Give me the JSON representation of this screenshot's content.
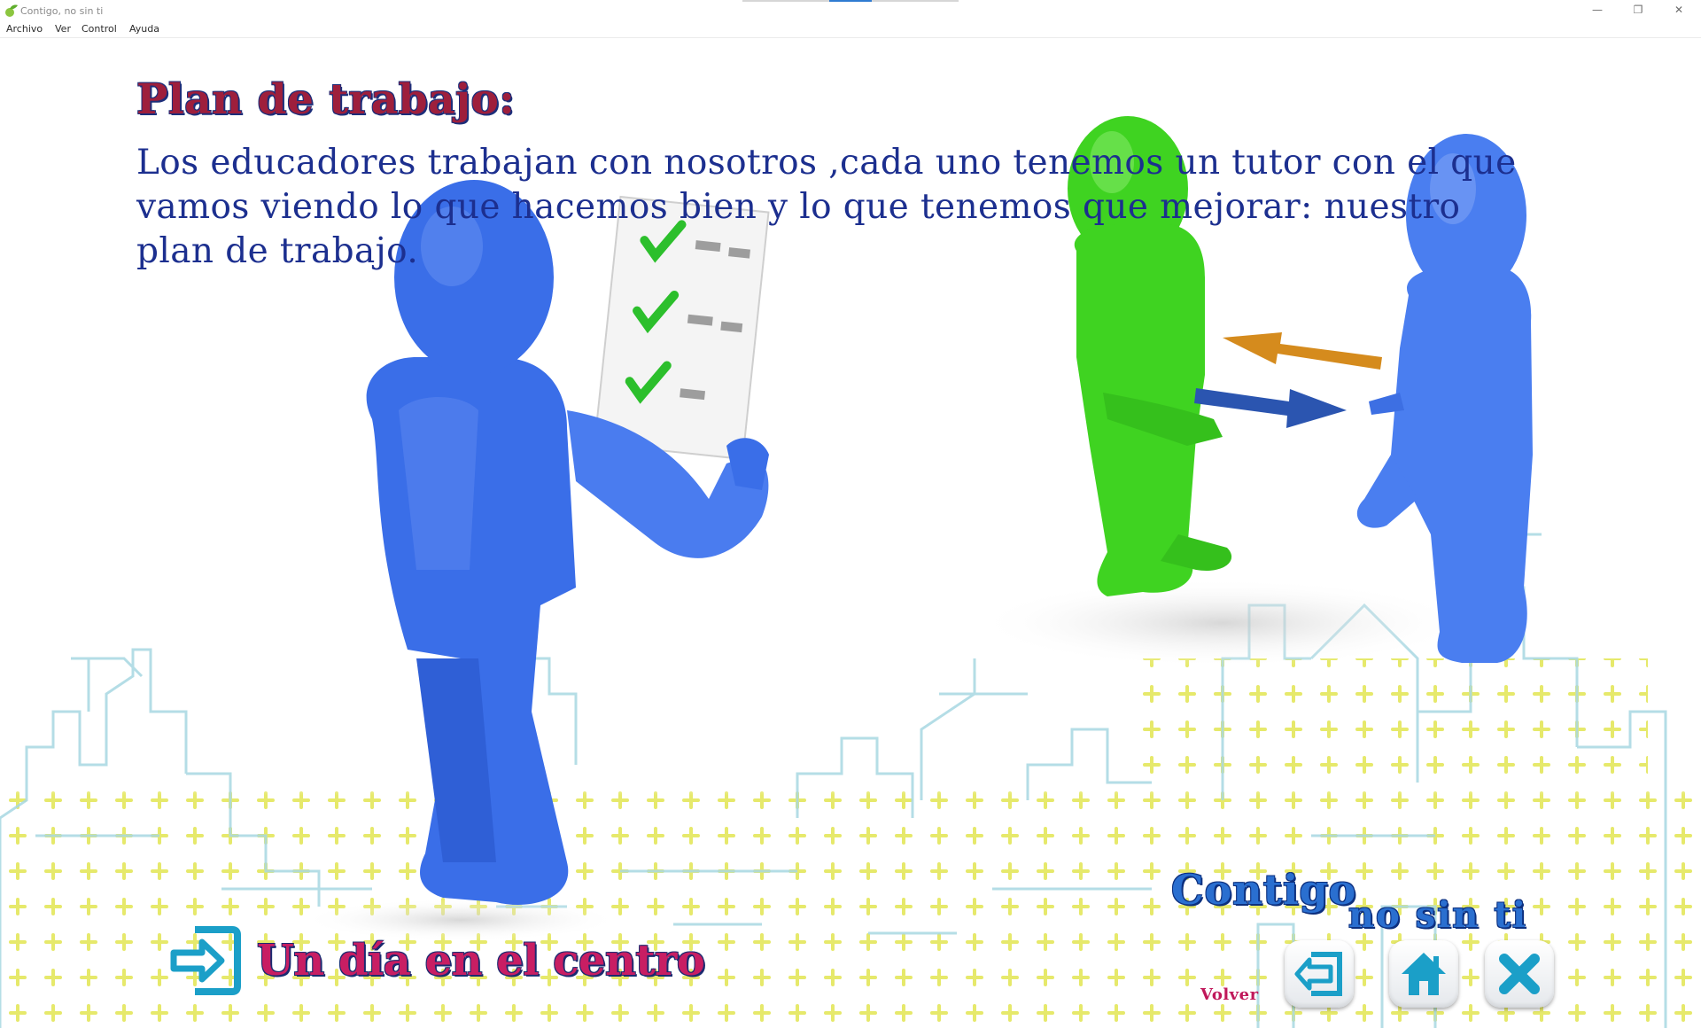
{
  "window": {
    "title": "Contigo, no sin ti",
    "controls": {
      "minimize": "—",
      "restore": "❐",
      "close": "✕"
    }
  },
  "menu": {
    "items": [
      "Archivo",
      "Ver",
      "Control",
      "Ayuda"
    ]
  },
  "content": {
    "heading": "Plan de trabajo:",
    "body": "Los educadores trabajan con nosotros ,cada uno tenemos un tutor con el que vamos viendo lo que hacemos bien y lo que tenemos que mejorar: nuestro plan de trabajo."
  },
  "footer": {
    "link_label": "Un día en el centro",
    "link_icon": "enter-arrow-icon"
  },
  "branding": {
    "line1": "Contigo",
    "line2": "no sin ti"
  },
  "nav": {
    "back_label": "Volver",
    "buttons": [
      {
        "name": "back-button",
        "icon": "back-arrow-icon"
      },
      {
        "name": "home-button",
        "icon": "home-icon"
      },
      {
        "name": "close-app-button",
        "icon": "close-icon"
      }
    ]
  },
  "colors": {
    "heading": "#9e1f3c",
    "body_text": "#1c2f8f",
    "footer_label": "#c81e63",
    "logo": "#2a6fd0",
    "icon_teal": "#1b9fc8",
    "figure_blue": "#3a6ee8",
    "figure_green": "#3fd321",
    "plus_yellow": "#e6e85e",
    "skyline": "#a8d8e2"
  }
}
